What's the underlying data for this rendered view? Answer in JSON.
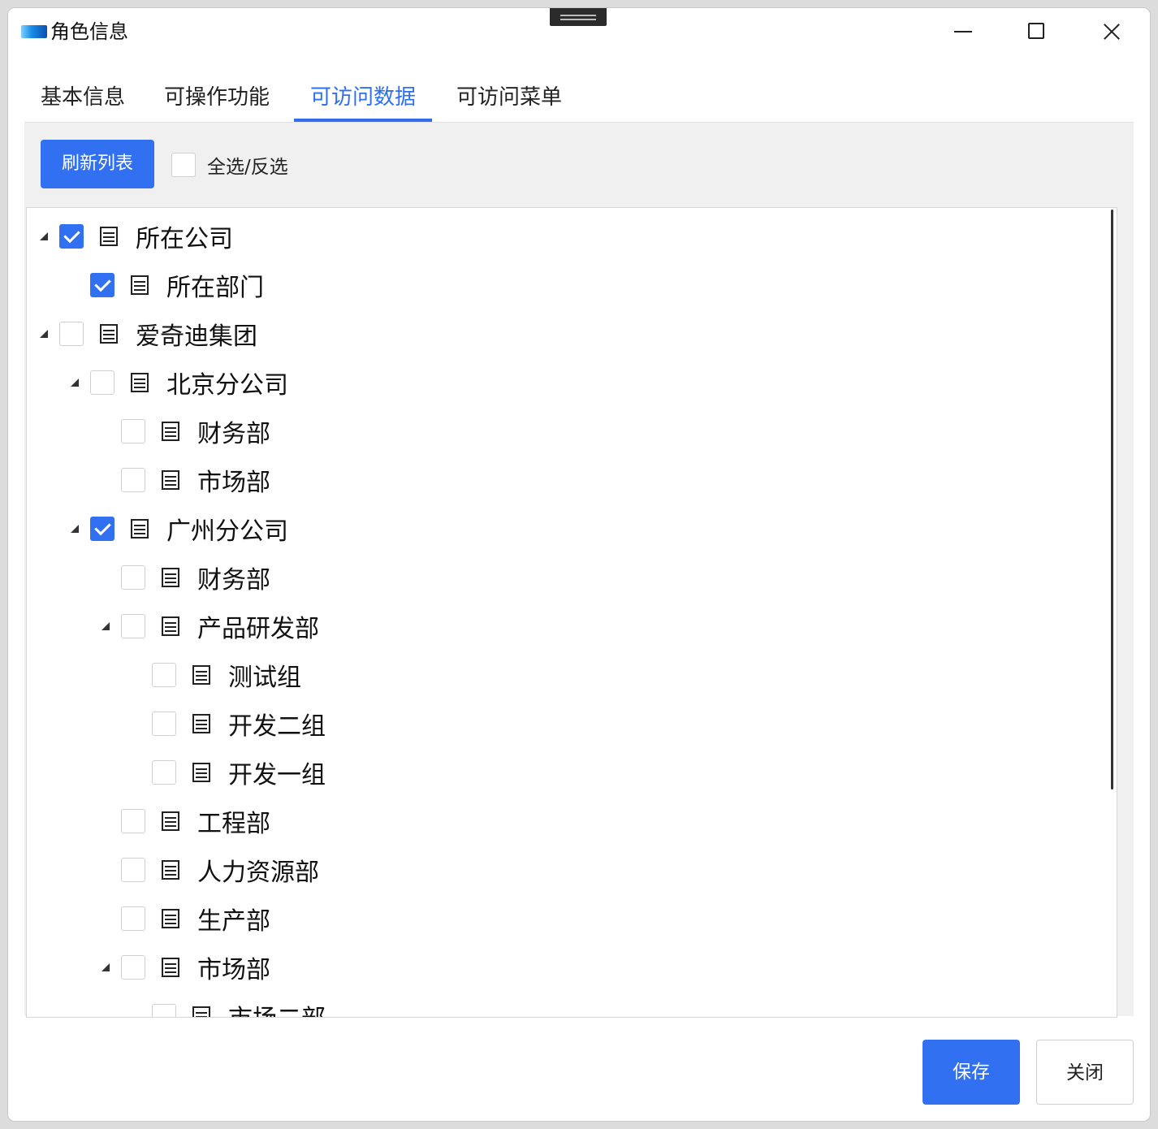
{
  "window": {
    "title": "角色信息"
  },
  "tabs": [
    {
      "label": "基本信息",
      "active": false
    },
    {
      "label": "可操作功能",
      "active": false
    },
    {
      "label": "可访问数据",
      "active": true
    },
    {
      "label": "可访问菜单",
      "active": false
    }
  ],
  "toolbar": {
    "refresh_label": "刷新列表",
    "select_all_label": "全选/反选",
    "select_all_checked": false
  },
  "tree": {
    "rows": [
      {
        "label": "所在公司",
        "depth": 0,
        "expandable": true,
        "checked": true
      },
      {
        "label": "所在部门",
        "depth": 1,
        "expandable": false,
        "checked": true
      },
      {
        "label": "爱奇迪集团",
        "depth": 0,
        "expandable": true,
        "checked": false
      },
      {
        "label": "北京分公司",
        "depth": 1,
        "expandable": true,
        "checked": false
      },
      {
        "label": "财务部",
        "depth": 2,
        "expandable": false,
        "checked": false
      },
      {
        "label": "市场部",
        "depth": 2,
        "expandable": false,
        "checked": false
      },
      {
        "label": "广州分公司",
        "depth": 1,
        "expandable": true,
        "checked": true
      },
      {
        "label": "财务部",
        "depth": 2,
        "expandable": false,
        "checked": false
      },
      {
        "label": "产品研发部",
        "depth": 2,
        "expandable": true,
        "checked": false
      },
      {
        "label": "测试组",
        "depth": 3,
        "expandable": false,
        "checked": false
      },
      {
        "label": "开发二组",
        "depth": 3,
        "expandable": false,
        "checked": false
      },
      {
        "label": "开发一组",
        "depth": 3,
        "expandable": false,
        "checked": false
      },
      {
        "label": "工程部",
        "depth": 2,
        "expandable": false,
        "checked": false
      },
      {
        "label": "人力资源部",
        "depth": 2,
        "expandable": false,
        "checked": false
      },
      {
        "label": "生产部",
        "depth": 2,
        "expandable": false,
        "checked": false
      },
      {
        "label": "市场部",
        "depth": 2,
        "expandable": true,
        "checked": false
      },
      {
        "label": "市场二部",
        "depth": 3,
        "expandable": false,
        "checked": false
      }
    ]
  },
  "footer": {
    "save_label": "保存",
    "close_label": "关闭"
  },
  "colors": {
    "accent": "#3170f0",
    "tab_active": "#2f6fef",
    "panel_bg": "#f0f0f0"
  },
  "icons": {
    "tree_node": "list-document-icon",
    "expand": "triangle-expanded-icon"
  }
}
